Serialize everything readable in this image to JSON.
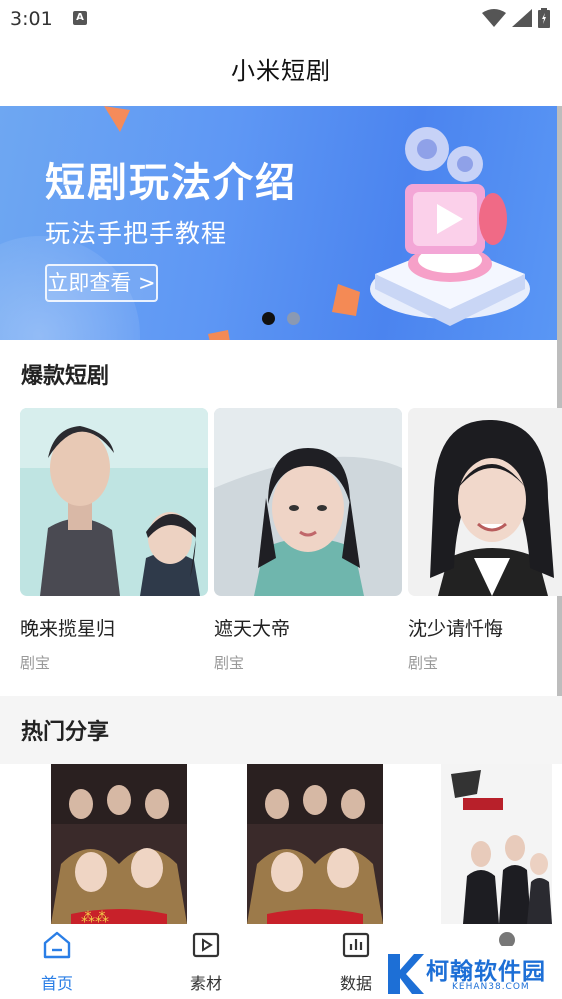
{
  "status_bar": {
    "time": "3:01",
    "notification": "A"
  },
  "app_bar": {
    "title": "小米短剧"
  },
  "banner": {
    "title": "短剧玩法介绍",
    "subtitle": "玩法手把手教程",
    "button_label": "立即查看 >",
    "page_count": 2,
    "active_page": 1
  },
  "hot_section": {
    "title": "爆款短剧",
    "items": [
      {
        "name": "晚来揽星归",
        "tag": "剧宝"
      },
      {
        "name": "遮天大帝",
        "tag": "剧宝"
      },
      {
        "name": "沈少请忏悔",
        "tag": "剧宝"
      }
    ]
  },
  "share_section": {
    "title": "热门分享"
  },
  "bottom_nav": {
    "items": [
      {
        "label": "首页",
        "icon": "home-icon",
        "active": true
      },
      {
        "label": "素材",
        "icon": "video-play-icon",
        "active": false
      },
      {
        "label": "数据",
        "icon": "data-chart-icon",
        "active": false
      },
      {
        "label": "",
        "icon": "profile-icon",
        "active": false
      }
    ]
  },
  "watermark": {
    "text": "柯翰软件园",
    "sub": "KEHAN38.COM"
  },
  "colors": {
    "accent": "#2a7ee6",
    "banner": "#5e97f4",
    "watermark": "#1d6fd6"
  }
}
